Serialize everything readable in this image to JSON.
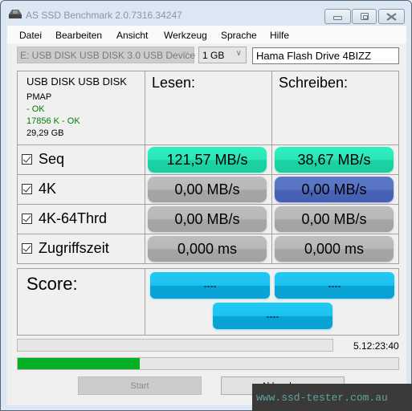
{
  "window": {
    "title": "AS SSD Benchmark 2.0.7316.34247",
    "controls": {
      "minimize": "minimize",
      "maximize": "maximize",
      "close": "close"
    }
  },
  "menu": {
    "items": [
      "Datei",
      "Bearbeiten",
      "Ansicht",
      "Werkzeug",
      "Sprache",
      "Hilfe"
    ]
  },
  "toolbar": {
    "drive_select": "E: USB DISK USB DISK 3.0 USB Device",
    "size_select": "1 GB",
    "name_input": "Hama Flash Drive 4BIZZ"
  },
  "info": {
    "disk_name": "USB DISK USB DISK",
    "firmware": "PMAP",
    "driver_status": " - OK",
    "alignment": "17856 K - OK",
    "capacity": "29,29 GB"
  },
  "columns": {
    "read": "Lesen:",
    "write": "Schreiben:"
  },
  "rows": [
    {
      "label": "Seq",
      "checked": true,
      "read": "121,57 MB/s",
      "write": "38,67 MB/s"
    },
    {
      "label": "4K",
      "checked": true,
      "read": "0,00 MB/s",
      "write": "0,00 MB/s"
    },
    {
      "label": "4K-64Thrd",
      "checked": true,
      "read": "0,00 MB/s",
      "write": "0,00 MB/s"
    },
    {
      "label": "Zugriffszeit",
      "checked": true,
      "read": "0,000 ms",
      "write": "0,000 ms"
    }
  ],
  "score": {
    "label": "Score:",
    "read": "----",
    "write": "----",
    "total": "----"
  },
  "status": {
    "elapsed_time": "5.12:23:40",
    "progress_percent": 32
  },
  "buttons": {
    "start": "Start",
    "abort": "Abbrechen"
  },
  "watermark": "www.ssd-tester.com.au",
  "colors": {
    "ok_text": "#008000",
    "result_green": "#1fdcac",
    "result_gray": "#b0b0b0",
    "result_blue": "#506bbd",
    "score_cyan": "#14b6e6",
    "progress_green": "#06b025"
  }
}
